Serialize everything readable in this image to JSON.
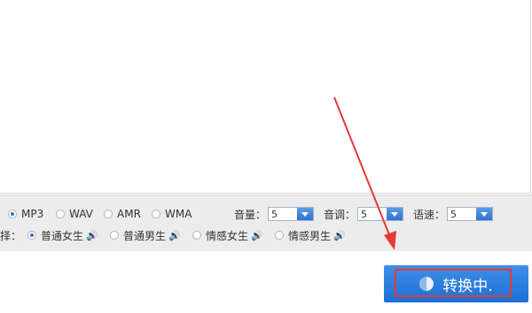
{
  "format": {
    "options": [
      {
        "label": "MP3",
        "checked": true
      },
      {
        "label": "WAV",
        "checked": false
      },
      {
        "label": "AMR",
        "checked": false
      },
      {
        "label": "WMA",
        "checked": false
      }
    ]
  },
  "volume": {
    "label": "音量：",
    "value": "5"
  },
  "pitch": {
    "label": "音调：",
    "value": "5"
  },
  "speed": {
    "label": "语速：",
    "value": "5"
  },
  "voice": {
    "label_partial": "择：",
    "options": [
      {
        "label": "普通女生",
        "checked": true
      },
      {
        "label": "普通男生",
        "checked": false
      },
      {
        "label": "情感女生",
        "checked": false
      },
      {
        "label": "情感男生",
        "checked": false
      }
    ]
  },
  "convert_button": {
    "label": "转换中."
  },
  "colors": {
    "accent": "#2b72d6",
    "annotation": "#e53935"
  },
  "icons": {
    "speaker": "speaker-icon",
    "spinner": "spinner-icon"
  }
}
